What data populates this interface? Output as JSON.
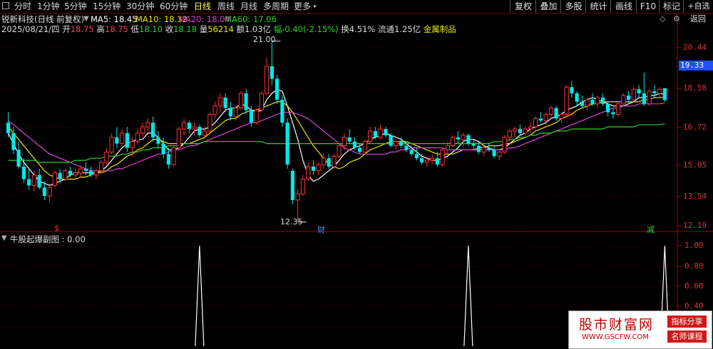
{
  "toolbar": {
    "periods": [
      "分时",
      "1分钟",
      "5分钟",
      "15分钟",
      "30分钟",
      "60分钟",
      "日线",
      "周线",
      "月线",
      "多周期",
      "更多"
    ],
    "active_period": "日线",
    "right_buttons": [
      "复权",
      "叠加",
      "多股",
      "统计",
      "画线",
      "F10",
      "标记",
      "+自选",
      "返回"
    ]
  },
  "stock": {
    "name_line": "锐新科技(日线 前复权)",
    "ma5": "MA5: 18.45",
    "ma10": "MA10: 18.32",
    "ma20": "MA20: 18.04",
    "ma60": "MA60: 17.06",
    "date": "2025/08/21/四",
    "open_label": "开",
    "open": "18.75",
    "high_label": "高",
    "high": "18.75",
    "low_label": "低",
    "low": "18.10",
    "close_label": "收",
    "close": "18.18",
    "vol_label": "量",
    "vol": "56214",
    "amount": "额1.03亿",
    "change": "幅-0.40(-2.15%)",
    "turnover": "换4.51%",
    "float": "流通1.25亿",
    "industry": "金属制品"
  },
  "colors": {
    "ma5": "#ffffff",
    "ma10": "#e8e800",
    "ma20": "#e040e0",
    "ma60": "#30d030",
    "up": "#ff3232",
    "down": "#00e8e8",
    "grid": "#5a0000"
  },
  "price_axis": {
    "labels": [
      "20.44",
      "18.58",
      "16.72",
      "15.05",
      "13.54",
      "12.19"
    ],
    "current": "19.33"
  },
  "annotations": {
    "max": "21.00",
    "min": "12.35"
  },
  "event_markers": [
    "$",
    "财",
    "减"
  ],
  "indicator": {
    "title": "牛股起爆副图 : 0.00",
    "axis_labels": [
      "1.00",
      "0.80",
      "0.60",
      "0.40"
    ]
  },
  "watermark": {
    "title": "股市财富网",
    "url": "WWW.GSCFW.COM",
    "tag1": "指标分享",
    "tag2": "名师课程"
  },
  "chart_data": {
    "type": "candlestick",
    "ylim": [
      12.0,
      21.4
    ],
    "candles": [
      [
        17.1,
        17.6,
        16.4,
        16.6
      ],
      [
        16.6,
        16.9,
        15.6,
        15.8
      ],
      [
        15.8,
        16.2,
        14.9,
        15.0
      ],
      [
        15.0,
        15.4,
        14.2,
        14.4
      ],
      [
        14.4,
        14.9,
        13.9,
        14.1
      ],
      [
        14.1,
        14.8,
        13.8,
        14.6
      ],
      [
        14.6,
        14.9,
        13.9,
        14.0
      ],
      [
        14.0,
        14.3,
        13.4,
        13.6
      ],
      [
        13.6,
        14.2,
        13.3,
        14.0
      ],
      [
        14.1,
        14.8,
        14.0,
        14.7
      ],
      [
        14.7,
        14.9,
        14.2,
        14.4
      ],
      [
        14.4,
        14.9,
        14.3,
        14.8
      ],
      [
        14.8,
        15.0,
        14.5,
        14.6
      ],
      [
        14.6,
        14.9,
        14.4,
        14.7
      ],
      [
        14.7,
        15.0,
        14.5,
        14.9
      ],
      [
        14.9,
        15.2,
        14.6,
        14.8
      ],
      [
        14.8,
        15.0,
        14.5,
        14.6
      ],
      [
        14.6,
        14.9,
        14.4,
        14.8
      ],
      [
        14.8,
        15.3,
        14.7,
        15.2
      ],
      [
        15.2,
        15.9,
        15.1,
        15.7
      ],
      [
        15.7,
        16.6,
        15.6,
        16.4
      ],
      [
        16.4,
        16.9,
        15.9,
        16.1
      ],
      [
        16.1,
        16.8,
        16.0,
        16.6
      ],
      [
        16.6,
        16.9,
        15.7,
        15.9
      ],
      [
        15.9,
        16.4,
        15.5,
        16.2
      ],
      [
        16.2,
        16.8,
        16.1,
        16.6
      ],
      [
        16.6,
        17.1,
        16.4,
        16.9
      ],
      [
        16.9,
        17.3,
        16.7,
        17.1
      ],
      [
        17.1,
        17.4,
        16.2,
        16.4
      ],
      [
        16.4,
        16.7,
        15.9,
        16.1
      ],
      [
        16.1,
        16.4,
        15.4,
        15.6
      ],
      [
        15.6,
        15.9,
        14.9,
        15.1
      ],
      [
        15.1,
        16.0,
        15.0,
        15.9
      ],
      [
        15.9,
        16.9,
        15.8,
        16.8
      ],
      [
        16.8,
        17.3,
        16.5,
        17.1
      ],
      [
        17.1,
        17.2,
        16.6,
        16.8
      ],
      [
        16.8,
        17.1,
        16.5,
        16.9
      ],
      [
        16.9,
        17.0,
        16.4,
        16.5
      ],
      [
        16.5,
        16.9,
        16.3,
        16.7
      ],
      [
        16.7,
        17.6,
        16.6,
        17.5
      ],
      [
        17.5,
        18.1,
        17.3,
        17.9
      ],
      [
        17.9,
        18.5,
        17.6,
        18.3
      ],
      [
        18.3,
        18.5,
        17.6,
        17.8
      ],
      [
        17.8,
        18.1,
        17.2,
        17.4
      ],
      [
        17.4,
        17.9,
        17.2,
        17.8
      ],
      [
        17.8,
        18.6,
        17.7,
        18.5
      ],
      [
        18.5,
        18.7,
        17.5,
        17.7
      ],
      [
        17.7,
        17.9,
        16.9,
        17.1
      ],
      [
        17.1,
        17.8,
        17.0,
        17.7
      ],
      [
        17.7,
        18.6,
        17.6,
        18.5
      ],
      [
        18.5,
        20.2,
        18.4,
        19.8
      ],
      [
        19.8,
        21.0,
        18.9,
        19.2
      ],
      [
        19.2,
        19.4,
        18.0,
        18.2
      ],
      [
        18.2,
        18.4,
        16.9,
        17.1
      ],
      [
        17.1,
        17.3,
        14.9,
        15.1
      ],
      [
        14.8,
        14.9,
        13.2,
        13.4
      ],
      [
        13.4,
        13.9,
        12.35,
        13.7
      ],
      [
        13.7,
        14.6,
        13.6,
        14.4
      ],
      [
        14.4,
        15.2,
        14.3,
        15.0
      ],
      [
        15.0,
        15.3,
        14.6,
        14.8
      ],
      [
        14.8,
        15.2,
        14.6,
        15.1
      ],
      [
        15.1,
        15.6,
        14.9,
        15.4
      ],
      [
        15.4,
        15.6,
        14.9,
        15.0
      ],
      [
        15.0,
        15.6,
        14.9,
        15.5
      ],
      [
        15.5,
        16.1,
        15.4,
        16.0
      ],
      [
        16.0,
        16.6,
        15.8,
        16.4
      ],
      [
        16.4,
        16.8,
        16.1,
        16.2
      ],
      [
        16.2,
        16.4,
        15.8,
        15.9
      ],
      [
        15.9,
        16.1,
        15.6,
        15.7
      ],
      [
        15.7,
        16.3,
        15.6,
        16.2
      ],
      [
        16.2,
        16.9,
        16.1,
        16.7
      ],
      [
        16.7,
        16.9,
        16.3,
        16.4
      ],
      [
        16.4,
        17.0,
        16.3,
        16.8
      ],
      [
        16.8,
        16.9,
        16.4,
        16.5
      ],
      [
        16.5,
        16.6,
        15.9,
        16.0
      ],
      [
        16.0,
        16.3,
        15.8,
        16.2
      ],
      [
        16.2,
        16.4,
        15.9,
        16.0
      ],
      [
        16.0,
        16.2,
        15.7,
        15.8
      ],
      [
        15.8,
        16.0,
        15.5,
        15.6
      ],
      [
        15.6,
        15.9,
        15.3,
        15.4
      ],
      [
        15.4,
        15.6,
        15.1,
        15.2
      ],
      [
        15.2,
        15.5,
        15.0,
        15.3
      ],
      [
        15.3,
        15.6,
        15.1,
        15.4
      ],
      [
        15.4,
        15.7,
        15.0,
        15.1
      ],
      [
        15.1,
        15.9,
        15.0,
        15.8
      ],
      [
        15.8,
        16.2,
        15.6,
        16.0
      ],
      [
        16.0,
        16.5,
        15.9,
        16.4
      ],
      [
        16.4,
        16.7,
        16.1,
        16.3
      ],
      [
        16.3,
        16.6,
        16.0,
        16.5
      ],
      [
        16.5,
        16.6,
        16.0,
        16.1
      ],
      [
        16.1,
        16.3,
        15.8,
        16.0
      ],
      [
        16.0,
        16.2,
        15.6,
        15.7
      ],
      [
        15.7,
        16.0,
        15.5,
        15.9
      ],
      [
        15.9,
        16.1,
        15.7,
        15.8
      ],
      [
        15.8,
        16.0,
        15.4,
        15.5
      ],
      [
        15.5,
        15.8,
        15.3,
        15.7
      ],
      [
        15.7,
        16.5,
        15.6,
        16.4
      ],
      [
        16.4,
        16.8,
        16.2,
        16.7
      ],
      [
        16.7,
        16.9,
        16.4,
        16.8
      ],
      [
        16.8,
        17.0,
        16.5,
        16.6
      ],
      [
        16.6,
        16.9,
        16.5,
        16.8
      ],
      [
        16.8,
        17.1,
        16.6,
        16.9
      ],
      [
        16.9,
        17.4,
        16.8,
        17.3
      ],
      [
        17.3,
        17.6,
        17.1,
        17.2
      ],
      [
        17.2,
        17.6,
        17.0,
        17.5
      ],
      [
        17.5,
        17.9,
        17.3,
        17.8
      ],
      [
        17.8,
        17.9,
        17.2,
        17.3
      ],
      [
        17.3,
        17.6,
        17.1,
        17.5
      ],
      [
        17.5,
        18.9,
        17.4,
        18.8
      ],
      [
        18.8,
        19.1,
        18.3,
        18.5
      ],
      [
        18.5,
        18.6,
        17.9,
        18.1
      ],
      [
        18.1,
        18.4,
        17.8,
        17.9
      ],
      [
        17.9,
        18.3,
        17.7,
        18.2
      ],
      [
        18.2,
        18.5,
        17.9,
        18.0
      ],
      [
        18.0,
        18.4,
        17.8,
        18.3
      ],
      [
        18.3,
        18.5,
        17.9,
        18.0
      ],
      [
        18.0,
        18.1,
        17.4,
        17.6
      ],
      [
        17.6,
        17.8,
        17.3,
        17.5
      ],
      [
        17.5,
        18.1,
        17.4,
        18.0
      ],
      [
        18.0,
        18.5,
        17.9,
        18.4
      ],
      [
        18.4,
        18.6,
        18.0,
        18.2
      ],
      [
        18.2,
        18.8,
        18.1,
        18.7
      ],
      [
        18.7,
        18.9,
        18.3,
        18.5
      ],
      [
        18.5,
        19.5,
        17.9,
        18.0
      ],
      [
        18.0,
        18.7,
        17.9,
        18.6
      ],
      [
        18.6,
        18.9,
        18.3,
        18.5
      ],
      [
        18.5,
        18.8,
        18.3,
        18.7
      ],
      [
        18.75,
        18.75,
        18.1,
        18.18
      ]
    ],
    "ma_series": [
      {
        "name": "MA5",
        "values": [
          16.6,
          16.1,
          15.6,
          15.2,
          14.9,
          14.6,
          14.3,
          14.2,
          14.1,
          14.2,
          14.3,
          14.4,
          14.6,
          14.7,
          14.7,
          14.7,
          14.7,
          14.7,
          14.8,
          15.0,
          15.3,
          15.6,
          15.9,
          16.1,
          16.2,
          16.3,
          16.3,
          16.6,
          16.6,
          16.4,
          16.1,
          15.8,
          15.8,
          15.9,
          16.1,
          16.4,
          16.7,
          16.8,
          16.8,
          16.9,
          17.1,
          17.4,
          17.7,
          17.8,
          17.8,
          18.0,
          17.9,
          17.7,
          17.6,
          17.7,
          18.2,
          18.5,
          18.7,
          18.6,
          17.9,
          17.1,
          16.3,
          15.3,
          14.6,
          14.3,
          14.4,
          14.6,
          14.8,
          15.0,
          15.3,
          15.6,
          15.8,
          15.9,
          16.0,
          16.1,
          16.3,
          16.4,
          16.5,
          16.6,
          16.5,
          16.4,
          16.3,
          16.1,
          15.9,
          15.7,
          15.5,
          15.4,
          15.3,
          15.3,
          15.4,
          15.5,
          15.7,
          15.9,
          16.2,
          16.3,
          16.3,
          16.2,
          16.0,
          15.9,
          15.8,
          15.8,
          15.9,
          16.1,
          16.3,
          16.5,
          16.6,
          16.8,
          16.9,
          17.0,
          17.1,
          17.3,
          17.4,
          17.5,
          17.7,
          17.8,
          17.9,
          18.1,
          18.2,
          18.3,
          18.2,
          18.1,
          18.0,
          17.9,
          17.9,
          17.9,
          18.0,
          18.1,
          18.3,
          18.3,
          18.4,
          18.4,
          18.5,
          18.45
        ]
      },
      {
        "name": "MA10",
        "values": [
          16.9,
          16.6,
          16.3,
          16.0,
          15.7,
          15.4,
          15.1,
          14.8,
          14.6,
          14.5,
          14.4,
          14.4,
          14.4,
          14.4,
          14.5,
          14.5,
          14.6,
          14.7,
          14.7,
          14.8,
          15.0,
          15.1,
          15.3,
          15.5,
          15.6,
          15.8,
          15.9,
          16.1,
          16.3,
          16.3,
          16.2,
          16.1,
          16.1,
          16.1,
          16.1,
          16.1,
          16.2,
          16.3,
          16.4,
          16.6,
          16.8,
          17.0,
          17.2,
          17.3,
          17.3,
          17.5,
          17.6,
          17.7,
          17.7,
          17.8,
          17.9,
          18.0,
          18.1,
          18.1,
          17.9,
          17.6,
          17.2,
          16.8,
          16.4,
          16.0,
          15.7,
          15.4,
          15.1,
          15.0,
          14.9,
          15.0,
          15.2,
          15.3,
          15.4,
          15.6,
          15.8,
          15.9,
          16.0,
          16.1,
          16.2,
          16.2,
          16.2,
          16.2,
          16.1,
          16.0,
          15.9,
          15.8,
          15.7,
          15.6,
          15.6,
          15.6,
          15.6,
          15.7,
          15.8,
          15.8,
          15.8,
          15.9,
          15.9,
          16.0,
          16.0,
          16.0,
          16.1,
          16.1,
          16.2,
          16.3,
          16.4,
          16.5,
          16.7,
          16.8,
          16.9,
          17.0,
          17.1,
          17.3,
          17.4,
          17.5,
          17.7,
          17.8,
          17.9,
          18.0,
          18.0,
          18.1,
          18.1,
          18.1,
          18.1,
          18.1,
          18.1,
          18.1,
          18.1,
          18.2,
          18.2,
          18.3,
          18.3,
          18.32
        ]
      },
      {
        "name": "MA20",
        "values": [
          17.2,
          17.0,
          16.8,
          16.6,
          16.4,
          16.2,
          16.0,
          15.8,
          15.6,
          15.5,
          15.4,
          15.3,
          15.2,
          15.1,
          15.0,
          14.9,
          14.8,
          14.8,
          14.8,
          14.8,
          14.8,
          14.9,
          14.9,
          15.0,
          15.1,
          15.2,
          15.3,
          15.4,
          15.5,
          15.6,
          15.6,
          15.7,
          15.8,
          15.8,
          15.9,
          16.0,
          16.0,
          16.1,
          16.2,
          16.3,
          16.4,
          16.5,
          16.6,
          16.7,
          16.8,
          16.9,
          17.0,
          17.1,
          17.1,
          17.2,
          17.3,
          17.4,
          17.5,
          17.6,
          17.6,
          17.6,
          17.5,
          17.4,
          17.3,
          17.1,
          16.9,
          16.7,
          16.5,
          16.3,
          16.1,
          15.9,
          15.8,
          15.7,
          15.6,
          15.6,
          15.6,
          15.6,
          15.6,
          15.6,
          15.7,
          15.7,
          15.8,
          15.8,
          15.9,
          15.9,
          15.9,
          15.9,
          15.9,
          15.9,
          15.9,
          15.8,
          15.8,
          15.8,
          15.8,
          15.8,
          15.8,
          15.8,
          15.8,
          15.8,
          15.8,
          15.8,
          15.8,
          15.9,
          15.9,
          16.0,
          16.1,
          16.2,
          16.3,
          16.4,
          16.5,
          16.6,
          16.7,
          16.8,
          16.9,
          17.0,
          17.1,
          17.2,
          17.3,
          17.4,
          17.5,
          17.6,
          17.7,
          17.8,
          17.8,
          17.9,
          17.9,
          17.9,
          18.0,
          18.0,
          18.0,
          18.0,
          18.0,
          18.04
        ]
      },
      {
        "name": "MA60",
        "values": [
          15.3,
          15.3,
          15.3,
          15.3,
          15.3,
          15.3,
          15.2,
          15.2,
          15.2,
          15.2,
          15.2,
          15.2,
          15.2,
          15.3,
          15.3,
          15.3,
          15.4,
          15.4,
          15.4,
          15.5,
          15.5,
          15.5,
          15.6,
          15.6,
          15.7,
          15.7,
          15.8,
          15.8,
          15.9,
          15.9,
          15.9,
          16.0,
          16.0,
          16.0,
          16.1,
          16.1,
          16.1,
          16.1,
          16.2,
          16.2,
          16.2,
          16.2,
          16.2,
          16.2,
          16.2,
          16.2,
          16.2,
          16.2,
          16.2,
          16.2,
          16.1,
          16.1,
          16.1,
          16.1,
          16.1,
          16.1,
          16.1,
          16.1,
          16.1,
          16.1,
          16.1,
          16.1,
          16.1,
          16.1,
          16.1,
          16.1,
          16.1,
          16.1,
          16.1,
          16.1,
          16.1,
          16.1,
          16.1,
          16.1,
          16.1,
          16.1,
          16.1,
          16.1,
          16.1,
          16.1,
          16.1,
          16.1,
          16.1,
          16.1,
          16.1,
          16.1,
          16.1,
          16.1,
          16.1,
          16.1,
          16.1,
          16.1,
          16.1,
          16.1,
          16.2,
          16.2,
          16.2,
          16.3,
          16.3,
          16.4,
          16.4,
          16.5,
          16.5,
          16.6,
          16.6,
          16.6,
          16.7,
          16.7,
          16.7,
          16.8,
          16.8,
          16.8,
          16.8,
          16.8,
          16.8,
          16.8,
          16.9,
          16.9,
          16.9,
          16.9,
          16.9,
          16.9,
          17.0,
          17.0,
          17.0,
          17.0,
          17.0,
          17.06
        ]
      }
    ],
    "indicator_series": {
      "name": "牛股起爆副图",
      "spike_indices": [
        37,
        89,
        127
      ],
      "values_at_spikes": [
        1.0,
        1.0,
        1.0
      ]
    }
  }
}
